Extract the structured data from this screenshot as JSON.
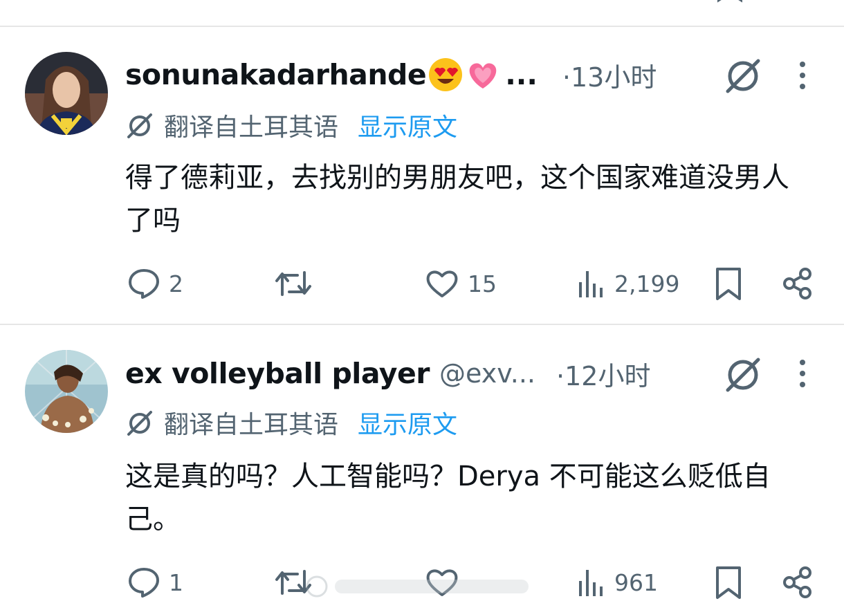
{
  "posts": [
    {
      "display_name": "sonunakadarhande",
      "name_emojis": [
        "smiling-face-with-heart-eyes",
        "growing-heart"
      ],
      "name_ellipsis": "...",
      "handle": "",
      "time": "·13小时",
      "translated_from": "翻译自土耳其语",
      "show_original": "显示原文",
      "text": "得了德莉亚，去找别的男朋友吧，这个国家难道没男人了吗",
      "replies": "2",
      "reposts": "",
      "likes": "15",
      "views": "2,199"
    },
    {
      "display_name": "ex volleyball player",
      "handle": "@exv...",
      "time": "·12小时",
      "translated_from": "翻译自土耳其语",
      "show_original": "显示原文",
      "text": "这是真的吗？人工智能吗？Derya 不可能这么贬低自己。",
      "replies": "1",
      "reposts": "",
      "likes": "",
      "views": "961"
    }
  ],
  "icons": {
    "reply": "speech-bubble-icon",
    "repost": "repost-arrows-icon",
    "like": "heart-icon",
    "views": "bar-chart-icon",
    "bookmark": "bookmark-icon",
    "share": "share-icon",
    "grok": "grok-slash-icon",
    "more": "more-vertical-icon"
  },
  "colors": {
    "text": "#0f1419",
    "secondary": "#536471",
    "link": "#1d9bf0",
    "divider": "#e6e6e6"
  }
}
